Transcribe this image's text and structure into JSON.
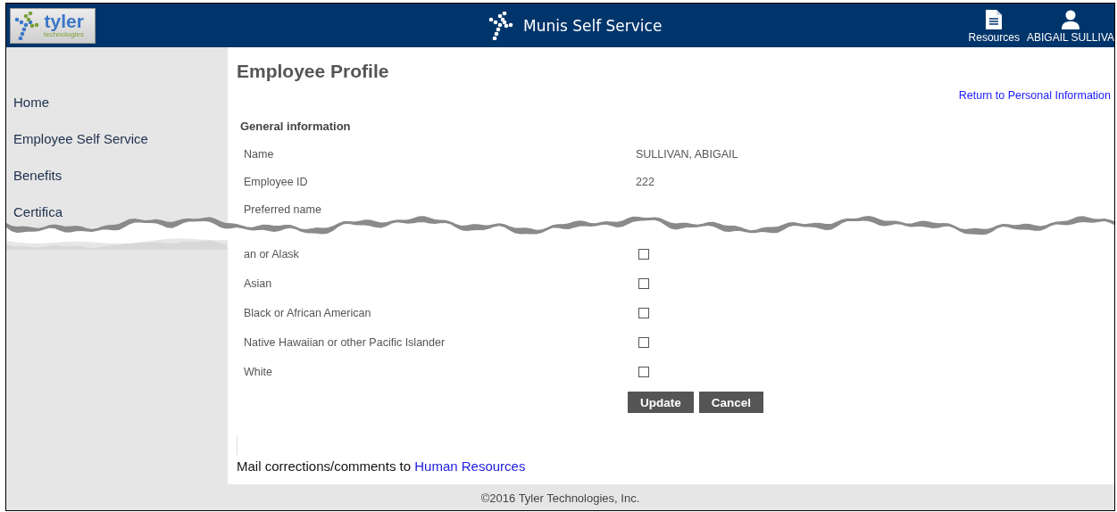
{
  "header": {
    "logo": {
      "name": "tyler",
      "tagline": "technologies"
    },
    "title": "Munis Self Service",
    "actions": [
      {
        "label": "Resources",
        "kind": "document"
      },
      {
        "label": "ABIGAIL SULLIVA",
        "kind": "user"
      }
    ]
  },
  "sidebar": {
    "items": [
      {
        "label": "Home"
      },
      {
        "label": "Employee Self Service"
      },
      {
        "label": "Benefits"
      },
      {
        "label": "Certifica"
      }
    ]
  },
  "page": {
    "title": "Employee Profile",
    "back_link": "Return to Personal Information",
    "section": "General information",
    "fields": [
      {
        "label": "Name",
        "value": "SULLIVAN, ABIGAIL"
      },
      {
        "label": "Employee ID",
        "value": "222"
      },
      {
        "label": "Preferred name"
      }
    ],
    "race_options": [
      {
        "label": "an or Alask",
        "checked": false
      },
      {
        "label": "Asian",
        "checked": false
      },
      {
        "label": "Black or African American",
        "checked": false
      },
      {
        "label": "Native Hawaiian or other Pacific Islander",
        "checked": false
      },
      {
        "label": "White",
        "checked": false
      }
    ],
    "buttons": [
      "Update",
      "Cancel"
    ],
    "mail_note": {
      "text": "Mail corrections/comments to",
      "link": "Human Resources"
    }
  },
  "footer": {
    "copyright": "©2016 Tyler Technologies, Inc."
  }
}
